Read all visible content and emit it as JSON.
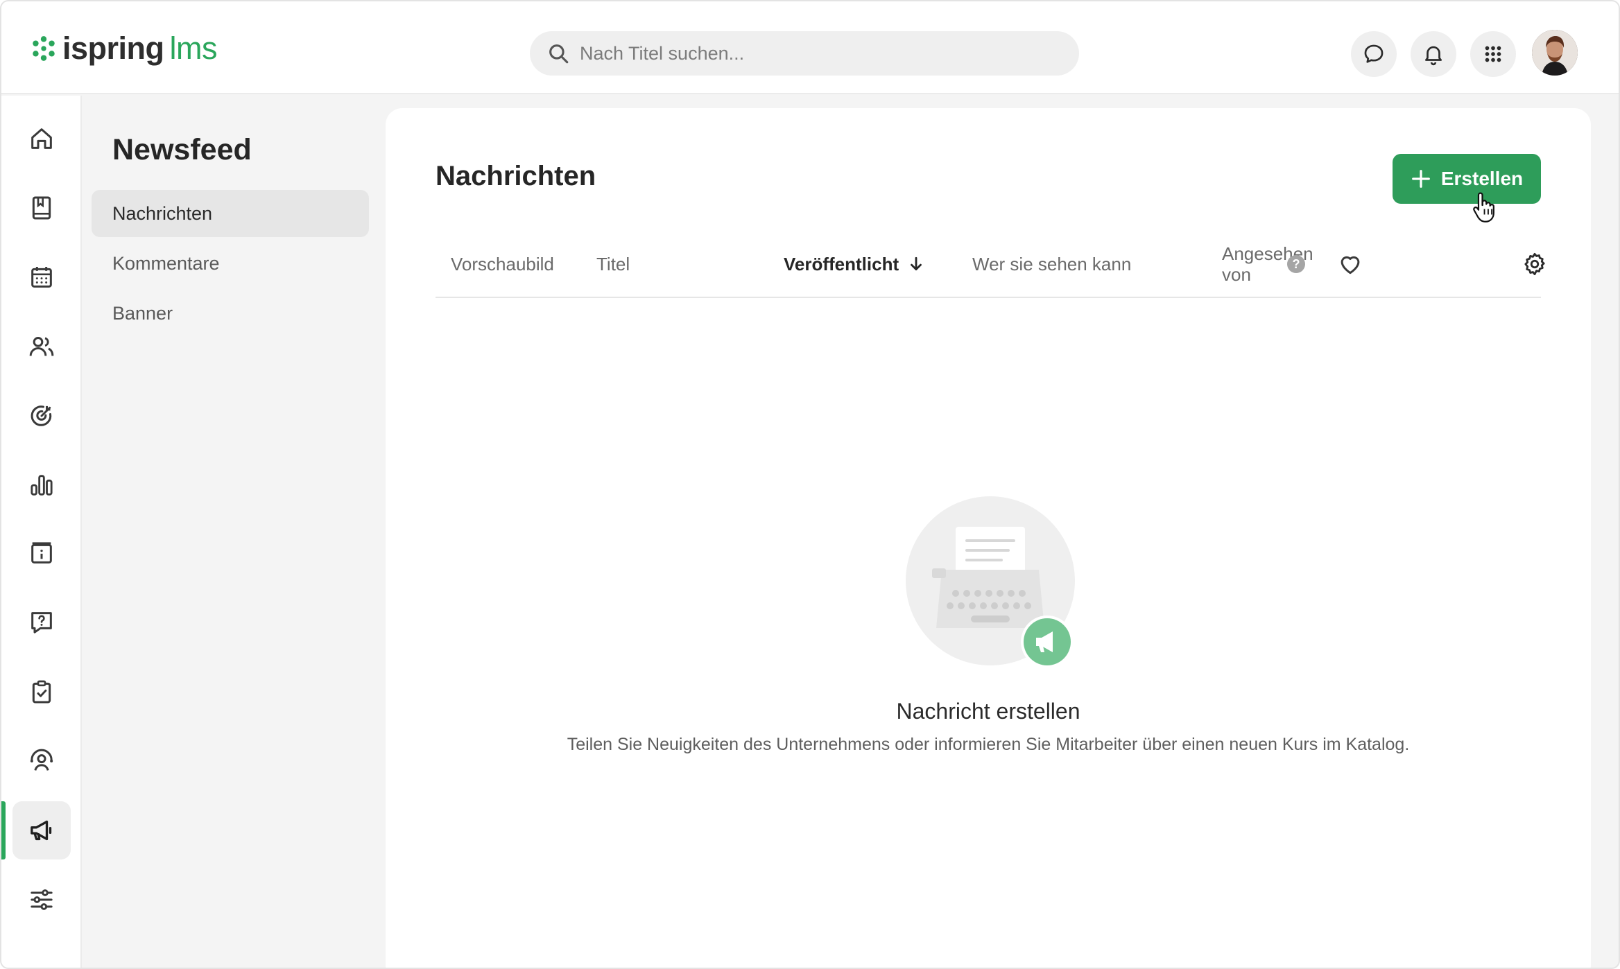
{
  "app": {
    "logo_primary": "ispring",
    "logo_secondary": "lms",
    "brand_color": "#2aa65b"
  },
  "search": {
    "placeholder": "Nach Titel suchen..."
  },
  "topbar": {
    "icons": [
      "chat-icon",
      "bell-icon",
      "apps-grid-icon"
    ],
    "avatar": "user-avatar"
  },
  "rail": {
    "items": [
      "home-icon",
      "book-icon",
      "calendar-icon",
      "users-icon",
      "target-icon",
      "bar-chart-icon",
      "info-board-icon",
      "question-chat-icon",
      "clipboard-check-icon",
      "user-support-icon",
      "megaphone-icon",
      "settings-sliders-icon"
    ],
    "active": "megaphone-icon"
  },
  "sidebar": {
    "title": "Newsfeed",
    "items": [
      {
        "label": "Nachrichten",
        "active": true
      },
      {
        "label": "Kommentare",
        "active": false
      },
      {
        "label": "Banner",
        "active": false
      }
    ]
  },
  "main": {
    "title": "Nachrichten",
    "create_button": "Erstellen",
    "columns": {
      "preview": "Vorschaubild",
      "title": "Titel",
      "published": "Veröffentlicht",
      "audience": "Wer sie sehen kann",
      "viewed_line1": "Angesehen",
      "viewed_line2": "von",
      "help": "?"
    },
    "empty": {
      "title": "Nachricht erstellen",
      "description": "Teilen Sie Neuigkeiten des Unternehmens oder informieren Sie Mitarbeiter über einen neuen Kurs im Katalog."
    }
  }
}
